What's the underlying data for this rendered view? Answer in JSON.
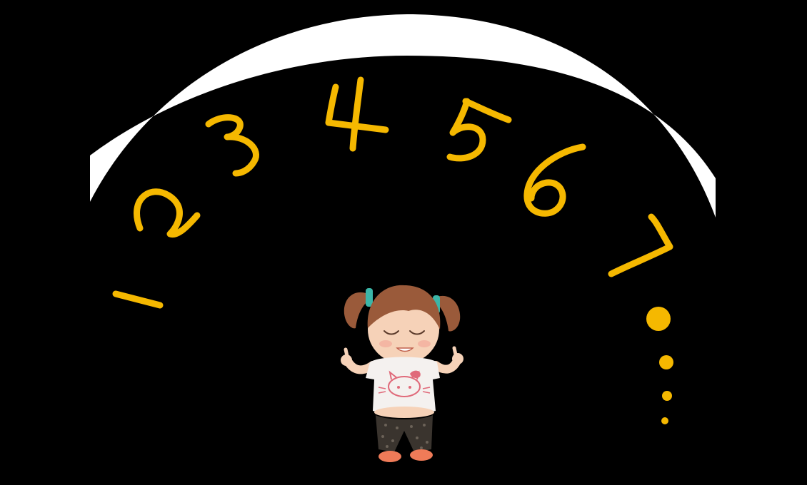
{
  "scene": {
    "background_color": "#000000",
    "arc_color": "#ffffff",
    "numeral_color": "#f5b800",
    "dot_color": "#f5b800",
    "numerals": [
      "1",
      "2",
      "3",
      "4",
      "5",
      "6",
      "7"
    ],
    "trailing_dots_count": 4,
    "character": {
      "icon": "girl-meditating-icon",
      "shirt_motif": "kitty-face-icon",
      "hair_color": "#9a5a3a",
      "skin_color": "#f6d2b8",
      "shirt_color": "#f4f1ef",
      "pants_color": "#3a342e",
      "shoe_color": "#ef7b58",
      "tie_color": "#3bb6a8"
    }
  }
}
